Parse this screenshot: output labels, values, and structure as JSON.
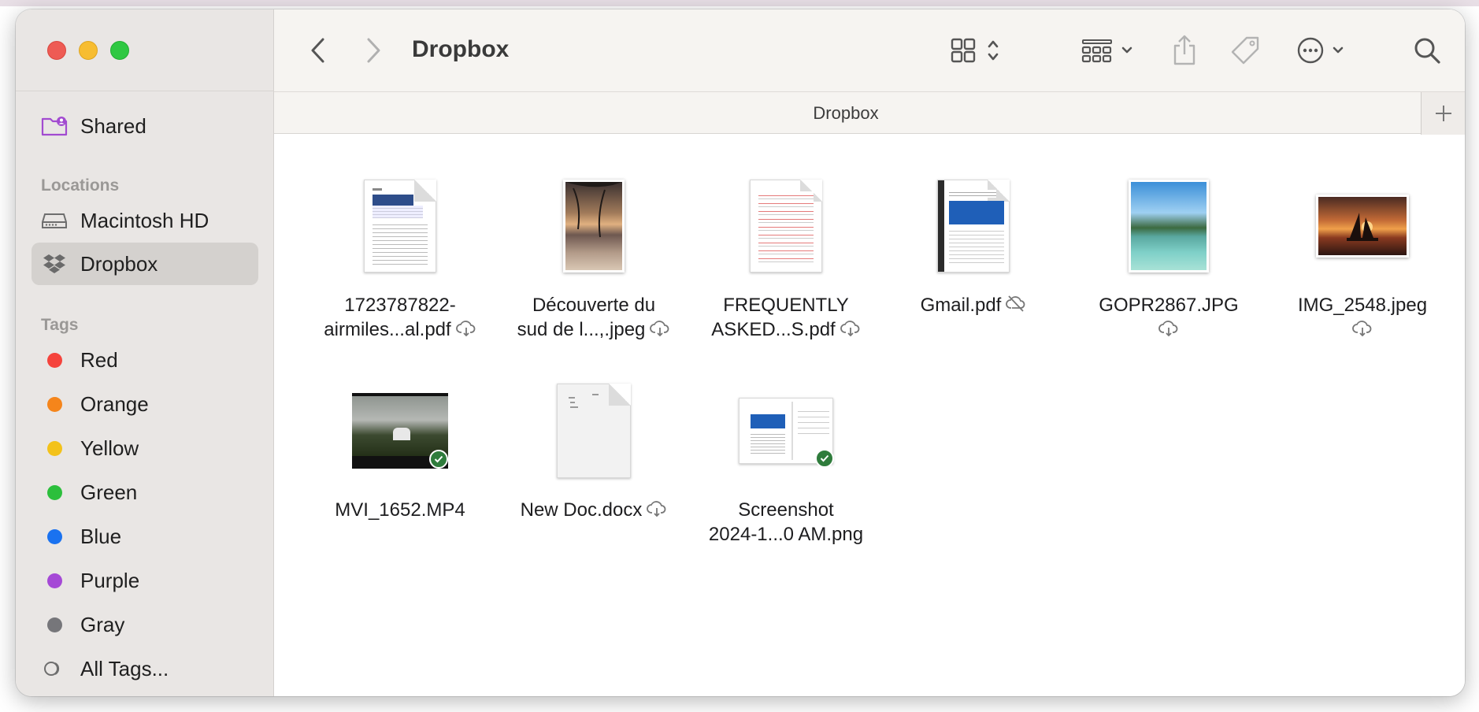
{
  "window_title": "Dropbox",
  "path_bar": "Dropbox",
  "sidebar": {
    "shared_label": "Shared",
    "locations_header": "Locations",
    "locations": [
      {
        "label": "Macintosh HD",
        "icon": "drive-icon",
        "selected": false
      },
      {
        "label": "Dropbox",
        "icon": "dropbox-icon",
        "selected": true
      }
    ],
    "tags_header": "Tags",
    "tags": [
      {
        "label": "Red",
        "color": "#f5433c"
      },
      {
        "label": "Orange",
        "color": "#f5851b"
      },
      {
        "label": "Yellow",
        "color": "#f3c21a"
      },
      {
        "label": "Green",
        "color": "#2cbf3c"
      },
      {
        "label": "Blue",
        "color": "#1a72f0"
      },
      {
        "label": "Purple",
        "color": "#a549d6"
      },
      {
        "label": "Gray",
        "color": "#8d8d90"
      }
    ],
    "all_tags_label": "All Tags..."
  },
  "toolbar": {
    "icons": [
      "back-icon",
      "forward-icon",
      "grid-view-icon",
      "group-icon",
      "share-icon",
      "tag-icon",
      "more-icon",
      "search-icon"
    ]
  },
  "files": [
    {
      "line1": "1723787822-",
      "line2": "airmiles...al.pdf",
      "status": "cloud"
    },
    {
      "line1": "Découverte du",
      "line2": "sud de l...,.jpeg",
      "status": "cloud"
    },
    {
      "line1": "FREQUENTLY",
      "line2": "ASKED...S.pdf",
      "status": "cloud"
    },
    {
      "line1": "Gmail.pdf",
      "line2": "",
      "status": "cloud-off"
    },
    {
      "line1": "GOPR2867.JPG",
      "line2": "",
      "status": "cloud-below"
    },
    {
      "line1": "IMG_2548.jpeg",
      "line2": "",
      "status": "cloud-below"
    },
    {
      "line1": "MVI_1652.MP4",
      "line2": "",
      "status": "synced"
    },
    {
      "line1": "New Doc.docx",
      "line2": "",
      "status": "cloud"
    },
    {
      "line1": "Screenshot",
      "line2": "2024-1...0 AM.png",
      "status": "synced"
    }
  ],
  "colors": {
    "sidebar_bg": "#e9e6e4",
    "toolbar_bg": "#f6f4f1",
    "synced_badge": "#2f7c3c"
  }
}
